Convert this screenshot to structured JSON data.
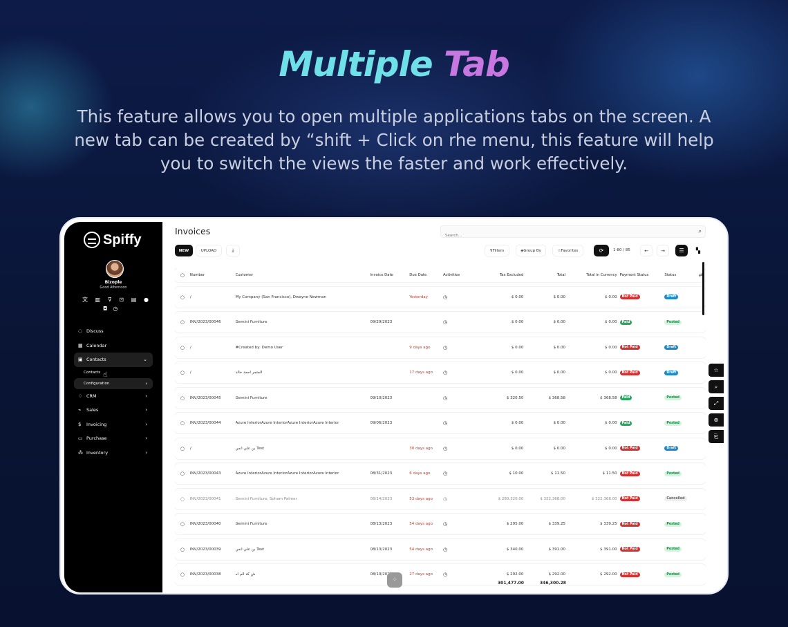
{
  "hero": {
    "title_part1": "Multiple",
    "title_part2": "Tab",
    "description": "This feature allows you to open multiple applications tabs on the screen. A new tab can be created by “shift + Click on rhe menu, this feature will help you to switch the views the faster and work effectively."
  },
  "app": {
    "name": "Spiffy"
  },
  "user": {
    "name": "Bizople",
    "greeting": "Good Afternoon"
  },
  "nav": {
    "discuss": "Discuss",
    "calendar": "Calendar",
    "contacts": "Contacts",
    "contacts_sub": "Contacts",
    "configuration": "Configuration",
    "crm": "CRM",
    "sales": "Sales",
    "invoicing": "Invoicing",
    "purchase": "Purchase",
    "inventory": "Inventory"
  },
  "page": {
    "title": "Invoices",
    "search_placeholder": "Search..."
  },
  "toolbar": {
    "new": "NEW",
    "upload": "UPLOAD",
    "filters": "Filters",
    "group_by": "Group By",
    "favorites": "Favorites",
    "pager": "1-80 / 85"
  },
  "colors": {
    "not_paid": "#d63031",
    "paid": "#2ba860",
    "draft": "#1e88c8",
    "posted_bg": "#d4f4df",
    "overdue_text": "#c0392b"
  },
  "table": {
    "headers": [
      "Number",
      "Customer",
      "Invoice Date",
      "Due Date",
      "Activities",
      "Tax Excluded",
      "Total",
      "Total in Currency",
      "Payment Status",
      "Status"
    ],
    "rows": [
      {
        "number": "/",
        "customer": "My Company (San Francisco), Dwayne Newman",
        "invoice_date": "",
        "due_date": "Yesterday",
        "tax_excluded": "$ 0.00",
        "total": "$ 0.00",
        "total_currency": "$ 0.00",
        "payment_status": "Not Paid",
        "status": "Draft"
      },
      {
        "number": "INV/2023/00046",
        "customer": "Gemini Furniture",
        "invoice_date": "09/29/2023",
        "due_date": "",
        "tax_excluded": "$ 0.00",
        "total": "$ 0.00",
        "total_currency": "$ 0.00",
        "payment_status": "Paid",
        "status": "Posted"
      },
      {
        "number": "/",
        "customer": "#Created by: Demo User",
        "invoice_date": "",
        "due_date": "9 days ago",
        "tax_excluded": "$ 0.00",
        "total": "$ 0.00",
        "total_currency": "$ 0.00",
        "payment_status": "Not Paid",
        "status": "Draft"
      },
      {
        "number": "/",
        "customer": "المتجر أحمد خالد",
        "invoice_date": "",
        "due_date": "17 days ago",
        "tax_excluded": "$ 0.00",
        "total": "$ 0.00",
        "total_currency": "$ 0.00",
        "payment_status": "Not Paid",
        "status": "Draft"
      },
      {
        "number": "INV/2023/00045",
        "customer": "Gemini Furniture",
        "invoice_date": "09/10/2023",
        "due_date": "",
        "tax_excluded": "$ 320.50",
        "total": "$ 368.58",
        "total_currency": "$ 368.58",
        "payment_status": "Paid",
        "status": "Posted"
      },
      {
        "number": "INV/2023/00044",
        "customer": "Azure InteriorAzure InteriorAzure InteriorAzure Interior",
        "invoice_date": "09/06/2023",
        "due_date": "",
        "tax_excluded": "$ 0.00",
        "total": "$ 0.00",
        "total_currency": "$ 0.00",
        "payment_status": "Paid",
        "status": "Posted"
      },
      {
        "number": "/",
        "customer": "بن علي أنس Test",
        "invoice_date": "",
        "due_date": "30 days ago",
        "tax_excluded": "$ 0.00",
        "total": "$ 0.00",
        "total_currency": "$ 0.00",
        "payment_status": "Not Paid",
        "status": "Draft"
      },
      {
        "number": "INV/2023/00043",
        "customer": "Azure InteriorAzure InteriorAzure InteriorAzure Interior",
        "invoice_date": "08/31/2023",
        "due_date": "6 days ago",
        "tax_excluded": "$ 10.00",
        "total": "$ 11.50",
        "total_currency": "$ 11.50",
        "payment_status": "Not Paid",
        "status": "Posted"
      },
      {
        "number": "INV/2023/00041",
        "customer": "Gemini Furniture, Soham Palmer",
        "invoice_date": "08/14/2023",
        "due_date": "53 days ago",
        "tax_excluded": "$ 280,320.00",
        "total": "$ 322,368.00",
        "total_currency": "$ 322,368.00",
        "payment_status": "Not Paid",
        "status": "Cancelled",
        "muted": true
      },
      {
        "number": "INV/2023/00040",
        "customer": "Gemini Furniture",
        "invoice_date": "08/13/2023",
        "due_date": "54 days ago",
        "tax_excluded": "$ 295.00",
        "total": "$ 339.25",
        "total_currency": "$ 339.25",
        "payment_status": "Not Paid",
        "status": "Posted"
      },
      {
        "number": "INV/2023/00039",
        "customer": "بن علي أنس Test",
        "invoice_date": "08/13/2023",
        "due_date": "54 days ago",
        "tax_excluded": "$ 340.00",
        "total": "$ 391.00",
        "total_currency": "$ 391.00",
        "payment_status": "Not Paid",
        "status": "Posted"
      },
      {
        "number": "INV/2023/00038",
        "customer": "ش كة الم اه",
        "invoice_date": "08/10/2023",
        "due_date": "27 days ago",
        "tax_excluded": "$ 292.00",
        "total": "$ 292.00",
        "total_currency": "$ 292.00",
        "payment_status": "Not Paid",
        "status": "Posted"
      }
    ],
    "footer": {
      "tax_excluded": "301,477.00",
      "total": "346,300.28"
    }
  }
}
